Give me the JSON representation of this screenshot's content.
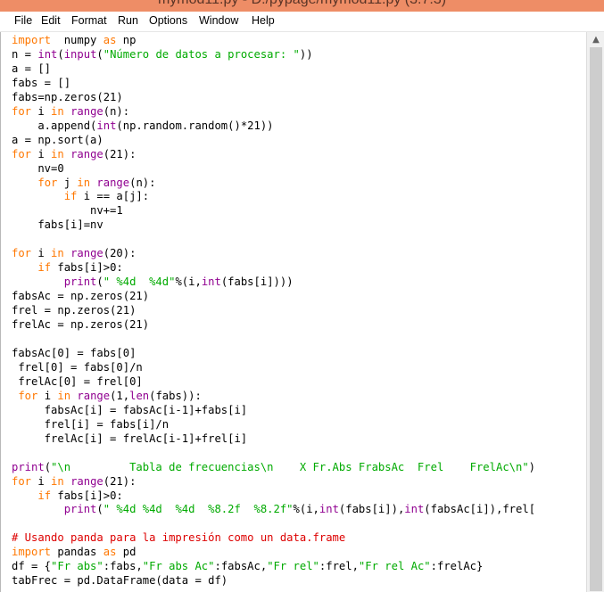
{
  "window": {
    "title": "mymod11.py - D:/pypage/mymod11.py (3.7.3)"
  },
  "menubar": {
    "items": [
      "File",
      "Edit",
      "Format",
      "Run",
      "Options",
      "Window",
      "Help"
    ]
  },
  "scrollbar": {
    "up_arrow_icon": "chevron-up-icon"
  },
  "colors": {
    "keyword": "#ff7700",
    "builtin": "#900090",
    "string": "#00aa00",
    "comment": "#dd0000",
    "titlebar": "#ee8d66"
  },
  "editor": {
    "lines": [
      [
        [
          "kw",
          "import"
        ],
        [
          "",
          "  numpy "
        ],
        [
          "kw",
          "as"
        ],
        [
          "",
          " np"
        ]
      ],
      [
        [
          "",
          "n = "
        ],
        [
          "bi",
          "int"
        ],
        [
          "",
          "("
        ],
        [
          "bi",
          "input"
        ],
        [
          "",
          "("
        ],
        [
          "st",
          "\"Número de datos a procesar: \""
        ],
        [
          "",
          "))"
        ]
      ],
      [
        [
          "",
          "a = []"
        ]
      ],
      [
        [
          "",
          "fabs = []"
        ]
      ],
      [
        [
          "",
          "fabs=np.zeros(21)"
        ]
      ],
      [
        [
          "kw",
          "for"
        ],
        [
          "",
          " i "
        ],
        [
          "kw",
          "in"
        ],
        [
          "",
          " "
        ],
        [
          "bi",
          "range"
        ],
        [
          "",
          "(n):"
        ]
      ],
      [
        [
          "",
          "    a.append("
        ],
        [
          "bi",
          "int"
        ],
        [
          "",
          "(np.random.random()*21))"
        ]
      ],
      [
        [
          "",
          "a = np.sort(a)"
        ]
      ],
      [
        [
          "kw",
          "for"
        ],
        [
          "",
          " i "
        ],
        [
          "kw",
          "in"
        ],
        [
          "",
          " "
        ],
        [
          "bi",
          "range"
        ],
        [
          "",
          "(21):"
        ]
      ],
      [
        [
          "",
          "    nv=0"
        ]
      ],
      [
        [
          "",
          "    "
        ],
        [
          "kw",
          "for"
        ],
        [
          "",
          " j "
        ],
        [
          "kw",
          "in"
        ],
        [
          "",
          " "
        ],
        [
          "bi",
          "range"
        ],
        [
          "",
          "(n):"
        ]
      ],
      [
        [
          "",
          "        "
        ],
        [
          "kw",
          "if"
        ],
        [
          "",
          " i == a[j]:"
        ]
      ],
      [
        [
          "",
          "            nv+=1"
        ]
      ],
      [
        [
          "",
          "    fabs[i]=nv"
        ]
      ],
      [
        [
          "",
          ""
        ]
      ],
      [
        [
          "kw",
          "for"
        ],
        [
          "",
          " i "
        ],
        [
          "kw",
          "in"
        ],
        [
          "",
          " "
        ],
        [
          "bi",
          "range"
        ],
        [
          "",
          "(20):"
        ]
      ],
      [
        [
          "",
          "    "
        ],
        [
          "kw",
          "if"
        ],
        [
          "",
          " fabs[i]>0:"
        ]
      ],
      [
        [
          "",
          "        "
        ],
        [
          "bi",
          "print"
        ],
        [
          "",
          "("
        ],
        [
          "st",
          "\" %4d  %4d\""
        ],
        [
          "",
          "%(i,"
        ],
        [
          "bi",
          "int"
        ],
        [
          "",
          "(fabs[i])))"
        ]
      ],
      [
        [
          "",
          "fabsAc = np.zeros(21)"
        ]
      ],
      [
        [
          "",
          "frel = np.zeros(21)"
        ]
      ],
      [
        [
          "",
          "frelAc = np.zeros(21)"
        ]
      ],
      [
        [
          "",
          ""
        ]
      ],
      [
        [
          "",
          "fabsAc[0] = fabs[0]"
        ]
      ],
      [
        [
          "",
          " frel[0] = fabs[0]/n"
        ]
      ],
      [
        [
          "",
          " frelAc[0] = frel[0]"
        ]
      ],
      [
        [
          "",
          "",
          " "
        ],
        [
          "kw",
          "for"
        ],
        [
          "",
          " i "
        ],
        [
          "kw",
          "in"
        ],
        [
          "",
          " "
        ],
        [
          "bi",
          "range"
        ],
        [
          "",
          "(1,"
        ],
        [
          "bi",
          "len"
        ],
        [
          "",
          "(fabs)):"
        ]
      ],
      [
        [
          "",
          "     fabsAc[i] = fabsAc[i-1]+fabs[i]"
        ]
      ],
      [
        [
          "",
          "     frel[i] = fabs[i]/n"
        ]
      ],
      [
        [
          "",
          "     frelAc[i] = frelAc[i-1]+frel[i]"
        ]
      ],
      [
        [
          "",
          ""
        ]
      ],
      [
        [
          "bi",
          "print"
        ],
        [
          "",
          "("
        ],
        [
          "st",
          "\"\\n         Tabla de frecuencias\\n    X Fr.Abs FrabsAc  Frel    FrelAc\\n\""
        ],
        [
          "",
          ")"
        ]
      ],
      [
        [
          "kw",
          "for"
        ],
        [
          "",
          " i "
        ],
        [
          "kw",
          "in"
        ],
        [
          "",
          " "
        ],
        [
          "bi",
          "range"
        ],
        [
          "",
          "(21):"
        ]
      ],
      [
        [
          "",
          "    "
        ],
        [
          "kw",
          "if"
        ],
        [
          "",
          " fabs[i]>0:"
        ]
      ],
      [
        [
          "",
          "        "
        ],
        [
          "bi",
          "print"
        ],
        [
          "",
          "("
        ],
        [
          "st",
          "\" %4d %4d  %4d  %8.2f  %8.2f\""
        ],
        [
          "",
          "%(i,"
        ],
        [
          "bi",
          "int"
        ],
        [
          "",
          "(fabs[i]),"
        ],
        [
          "bi",
          "int"
        ],
        [
          "",
          "(fabsAc[i]),frel["
        ]
      ],
      [
        [
          "",
          ""
        ]
      ],
      [
        [
          "cm",
          "# Usando panda para la impresión como un data.frame"
        ]
      ],
      [
        [
          "kw",
          "import"
        ],
        [
          "",
          " pandas "
        ],
        [
          "kw",
          "as"
        ],
        [
          "",
          " pd"
        ]
      ],
      [
        [
          "",
          "df = {"
        ],
        [
          "st",
          "\"Fr abs\""
        ],
        [
          "",
          ":fabs,"
        ],
        [
          "st",
          "\"Fr abs Ac\""
        ],
        [
          "",
          ":fabsAc,"
        ],
        [
          "st",
          "\"Fr rel\""
        ],
        [
          "",
          ":frel,"
        ],
        [
          "st",
          "\"Fr rel Ac\""
        ],
        [
          "",
          ":frelAc}"
        ]
      ],
      [
        [
          "",
          "tabFrec = pd.DataFrame(data = df)"
        ]
      ]
    ]
  }
}
